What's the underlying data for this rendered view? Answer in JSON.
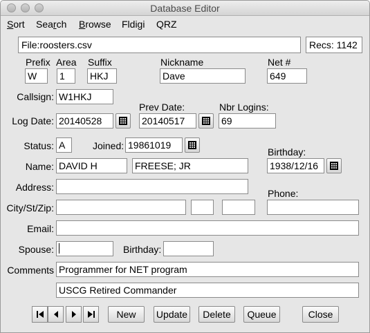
{
  "window": {
    "title": "Database Editor"
  },
  "menu": [
    {
      "label": "Sort",
      "accel": "S",
      "rest": "ort"
    },
    {
      "label": "Search",
      "accel": "r",
      "pre": "Sea",
      "rest": "ch"
    },
    {
      "label": "Browse",
      "accel": "B",
      "rest": "rowse"
    },
    {
      "label": "Fldigi"
    },
    {
      "label": "QRZ"
    }
  ],
  "status": {
    "file": "File:roosters.csv",
    "records": "Recs: 1142"
  },
  "labels": {
    "prefix": "Prefix",
    "area": "Area",
    "suffix": "Suffix",
    "nickname": "Nickname",
    "net_number": "Net #",
    "callsign": "Callsign:",
    "prev_date": "Prev Date:",
    "nbr_logins": "Nbr Logins:",
    "log_date": "Log Date:",
    "status": "Status:",
    "joined": "Joined:",
    "birthday": "Birthday:",
    "name": "Name:",
    "address": "Address:",
    "phone": "Phone:",
    "city_st_zip": "City/St/Zip:",
    "email": "Email:",
    "spouse": "Spouse:",
    "spouse_birthday": "Birthday:",
    "comments": "Comments"
  },
  "fields": {
    "prefix": "W",
    "area": "1",
    "suffix": "HKJ",
    "nickname": "Dave",
    "net_number": "649",
    "callsign": "W1HKJ",
    "log_date": "20140528",
    "prev_date": "20140517",
    "nbr_logins": "69",
    "status": "A",
    "joined": "19861019",
    "birthday": "1938/12/16",
    "first_name": "DAVID H",
    "last_name": "FREESE; JR",
    "address": "",
    "city": "",
    "state": "",
    "zip": "",
    "phone": "",
    "email": "",
    "spouse": "",
    "spouse_birthday": "",
    "comment1": "Programmer for NET program",
    "comment2": "USCG Retired Commander"
  },
  "buttons": {
    "new": "New",
    "update": "Update",
    "delete": "Delete",
    "queue": "Queue",
    "close": "Close"
  },
  "icons": {
    "calendar": "calendar-icon",
    "first": "first-record-icon",
    "prev": "previous-record-icon",
    "next": "next-record-icon",
    "last": "last-record-icon"
  }
}
